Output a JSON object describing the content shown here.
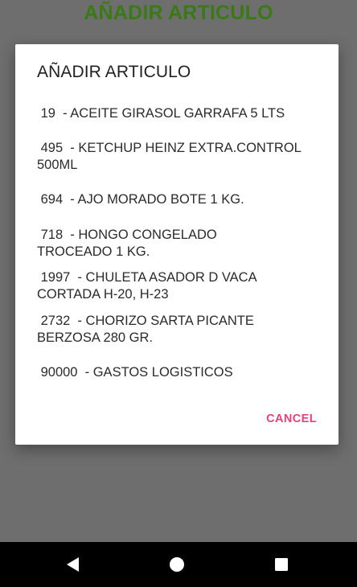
{
  "app": {
    "title": "AÑADIR ARTICULO"
  },
  "dialog": {
    "title": "AÑADIR ARTICULO",
    "items": [
      {
        "text": " 19  - ACEITE GIRASOL GARRAFA 5 LTS"
      },
      {
        "text": " 495  - KETCHUP HEINZ EXTRA.CONTROL\n500ML"
      },
      {
        "text": " 694  - AJO MORADO BOTE 1 KG."
      },
      {
        "text": " 718  - HONGO CONGELADO\nTROCEADO 1 KG."
      },
      {
        "text": " 1997  - CHULETA ASADOR D VACA\nCORTADA H-20, H-23"
      },
      {
        "text": " 2732  - CHORIZO SARTA PICANTE\nBERZOSA 280 GR."
      },
      {
        "text": " 90000  - GASTOS LOGISTICOS"
      }
    ],
    "cancel_label": "CANCEL"
  },
  "navbar": {
    "icons": [
      "back-icon",
      "home-icon",
      "recents-icon"
    ]
  },
  "colors": {
    "app_title": "#3a7a16",
    "accent": "#e8407a",
    "scrim": "#6e6e6e"
  }
}
